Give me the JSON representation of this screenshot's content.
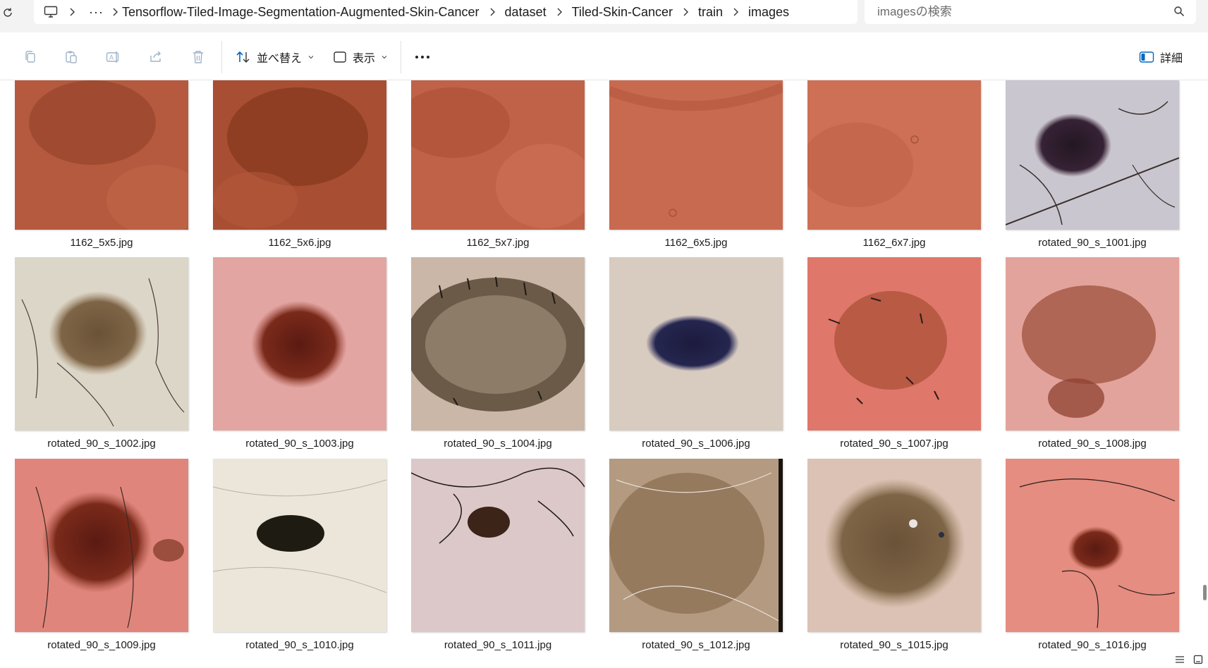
{
  "address_bar": {
    "breadcrumb": [
      "Tensorflow-Tiled-Image-Segmentation-Augmented-Skin-Cancer",
      "dataset",
      "Tiled-Skin-Cancer",
      "train",
      "images"
    ],
    "overflow_label": "···"
  },
  "search": {
    "placeholder": "imagesの検索"
  },
  "toolbar": {
    "sort_label": "並べ替え",
    "view_label": "表示",
    "more_label": "•••",
    "details_label": "詳細"
  },
  "files": [
    "1162_5x5.jpg",
    "1162_5x6.jpg",
    "1162_5x7.jpg",
    "1162_6x5.jpg",
    "1162_6x7.jpg",
    "rotated_90_s_1001.jpg",
    "rotated_90_s_1002.jpg",
    "rotated_90_s_1003.jpg",
    "rotated_90_s_1004.jpg",
    "rotated_90_s_1006.jpg",
    "rotated_90_s_1007.jpg",
    "rotated_90_s_1008.jpg",
    "rotated_90_s_1009.jpg",
    "rotated_90_s_1010.jpg",
    "rotated_90_s_1011.jpg",
    "rotated_90_s_1012.jpg",
    "rotated_90_s_1015.jpg",
    "rotated_90_s_1016.jpg"
  ],
  "colors": {
    "accent": "#0067c0",
    "icon_disabled": "#a0b4c8",
    "header_bg": "#f3f3f3"
  }
}
